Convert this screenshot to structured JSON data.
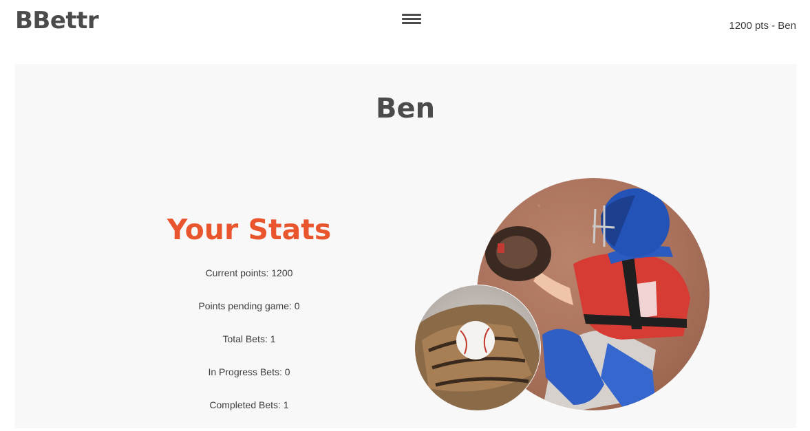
{
  "header": {
    "logo": "BBettr",
    "user_info": "1200 pts - Ben"
  },
  "profile": {
    "name": "Ben"
  },
  "stats": {
    "title": "Your Stats",
    "rows": [
      "Current points: 1200",
      "Points pending game: 0",
      "Total Bets: 1",
      "In Progress Bets: 0",
      "Completed Bets: 1"
    ]
  },
  "colors": {
    "accent": "#e9562e",
    "text": "#4b4b4b",
    "panel_bg": "#f8f8f8"
  },
  "icons": {
    "menu": "hamburger-menu-icon"
  }
}
